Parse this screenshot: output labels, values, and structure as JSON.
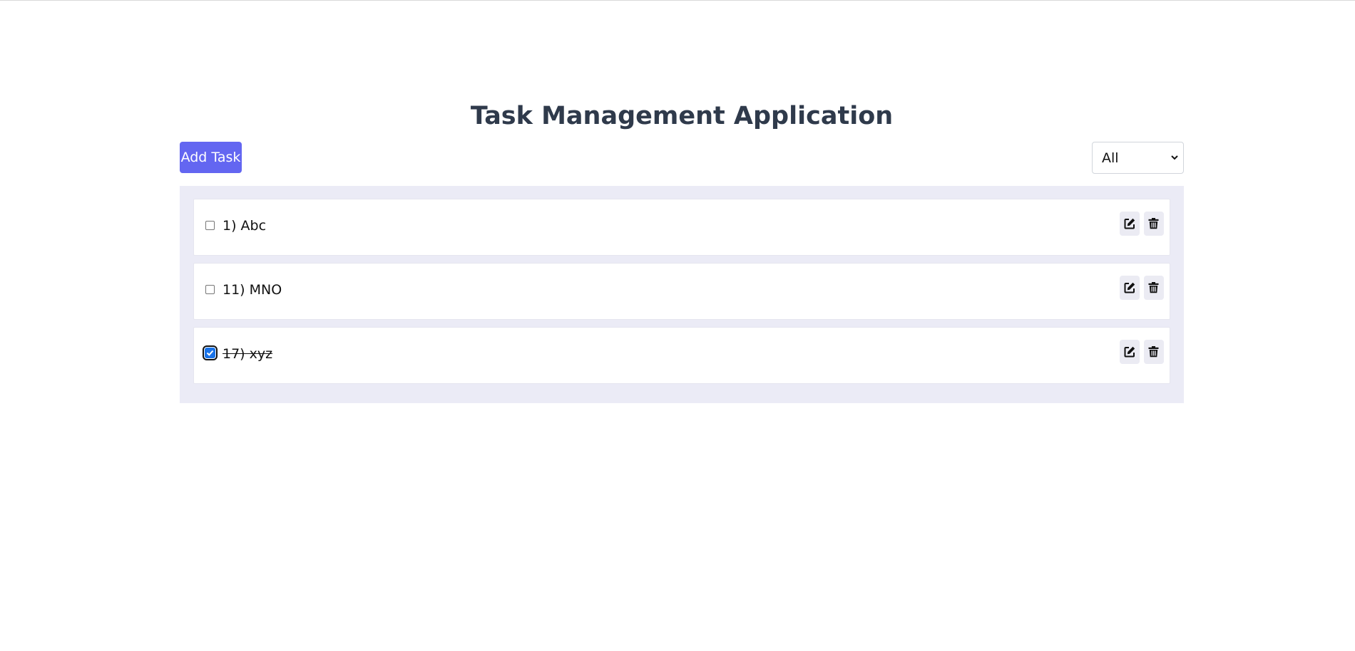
{
  "app": {
    "title": "Task Management Application"
  },
  "toolbar": {
    "add_label": "Add Task",
    "filter": {
      "selected": "All"
    }
  },
  "tasks": [
    {
      "label": "1) Abc",
      "completed": false
    },
    {
      "label": "11) MNO",
      "completed": false
    },
    {
      "label": "17) xyz",
      "completed": true
    }
  ],
  "colors": {
    "accent": "#6366f1",
    "title": "#2f3a4b",
    "panel": "#ebebf6",
    "checkbox_checked": "#1a73e8"
  },
  "icons": {
    "edit": "edit-icon",
    "delete": "trash-icon",
    "dropdown": "chevron-down-icon"
  }
}
